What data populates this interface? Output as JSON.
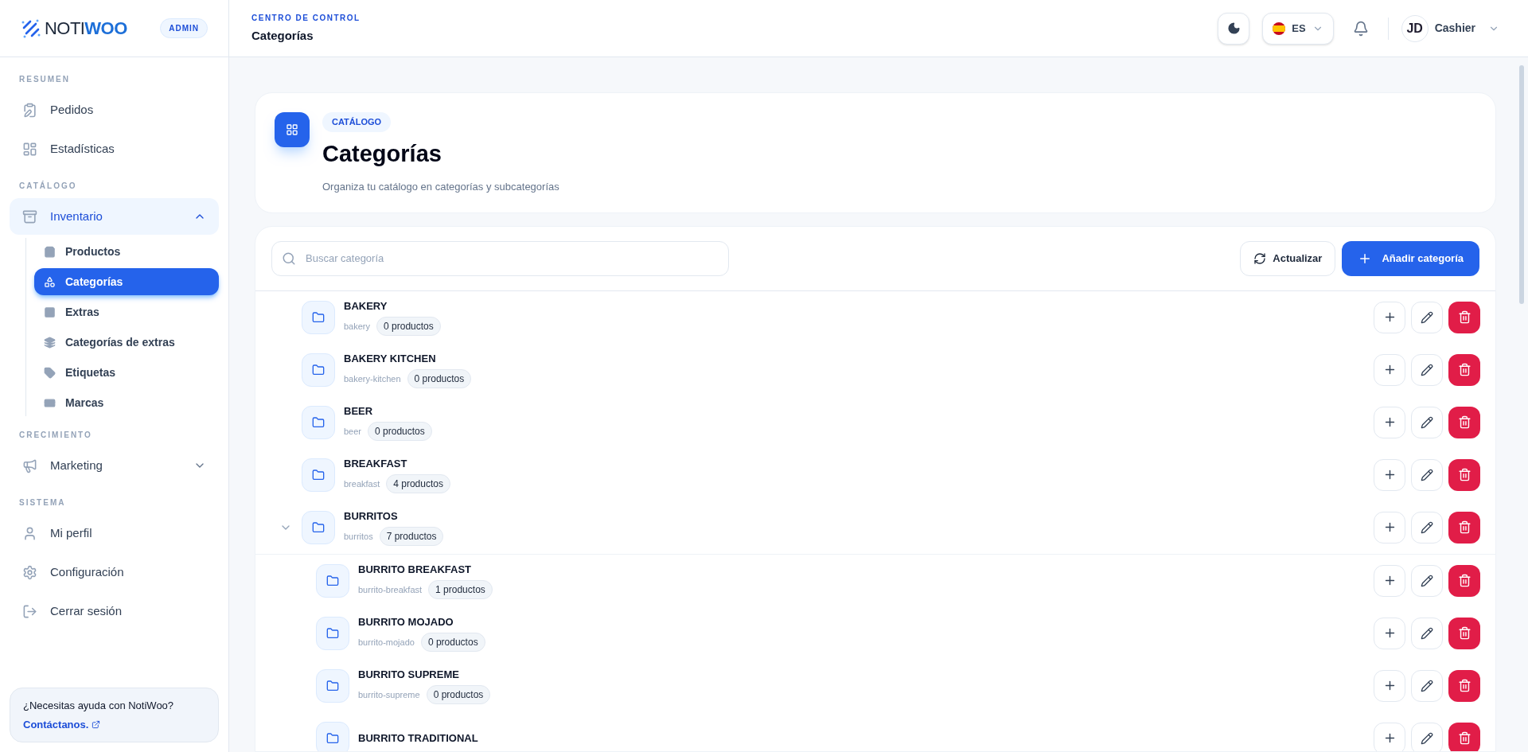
{
  "brand": {
    "name_light": "NOTI",
    "name_bold": "WOO",
    "badge": "ADMIN"
  },
  "sidebar": {
    "sections": [
      {
        "title": "RESUMEN",
        "items": [
          {
            "label": "Pedidos",
            "selected": false
          },
          {
            "label": "Estadísticas",
            "selected": false
          }
        ]
      },
      {
        "title": "CATÁLOGO",
        "items": [
          {
            "label": "Inventario",
            "selected": false,
            "expanded": true,
            "children": [
              {
                "label": "Productos",
                "selected": false
              },
              {
                "label": "Categorías",
                "selected": true
              },
              {
                "label": "Extras",
                "selected": false
              },
              {
                "label": "Categorías de extras",
                "selected": false
              },
              {
                "label": "Etiquetas",
                "selected": false
              },
              {
                "label": "Marcas",
                "selected": false
              }
            ]
          }
        ]
      },
      {
        "title": "CRECIMIENTO",
        "items": [
          {
            "label": "Marketing",
            "selected": false,
            "expanded": false
          }
        ]
      },
      {
        "title": "SISTEMA",
        "items": [
          {
            "label": "Mi perfil",
            "selected": false
          },
          {
            "label": "Configuración",
            "selected": false
          },
          {
            "label": "Cerrar sesión",
            "selected": false
          }
        ]
      }
    ],
    "help": {
      "text": "¿Necesitas ayuda con NotiWoo?",
      "link": "Contáctanos."
    }
  },
  "header": {
    "overline": "CENTRO DE CONTROL",
    "title": "Categorías",
    "language": "ES",
    "avatar": "JD",
    "user": "Cashier"
  },
  "hero": {
    "badge": "CATÁLOGO",
    "title": "Categorías",
    "subtitle": "Organiza tu catálogo en categorías y subcategorías"
  },
  "toolbar": {
    "search_placeholder": "Buscar categoría",
    "refresh": "Actualizar",
    "add": "Añadir categoría"
  },
  "categories": [
    {
      "name": "BAKERY",
      "slug": "bakery",
      "count": "0 productos"
    },
    {
      "name": "BAKERY KITCHEN",
      "slug": "bakery-kitchen",
      "count": "0 productos"
    },
    {
      "name": "BEER",
      "slug": "beer",
      "count": "0 productos"
    },
    {
      "name": "BREAKFAST",
      "slug": "breakfast",
      "count": "4 productos"
    },
    {
      "name": "BURRITOS",
      "slug": "burritos",
      "count": "7 productos",
      "expanded": true,
      "children": [
        {
          "name": "BURRITO BREAKFAST",
          "slug": "burrito-breakfast",
          "count": "1 productos"
        },
        {
          "name": "BURRITO MOJADO",
          "slug": "burrito-mojado",
          "count": "0 productos"
        },
        {
          "name": "BURRITO SUPREME",
          "slug": "burrito-supreme",
          "count": "0 productos"
        },
        {
          "name": "BURRITO TRADITIONAL"
        }
      ]
    }
  ]
}
